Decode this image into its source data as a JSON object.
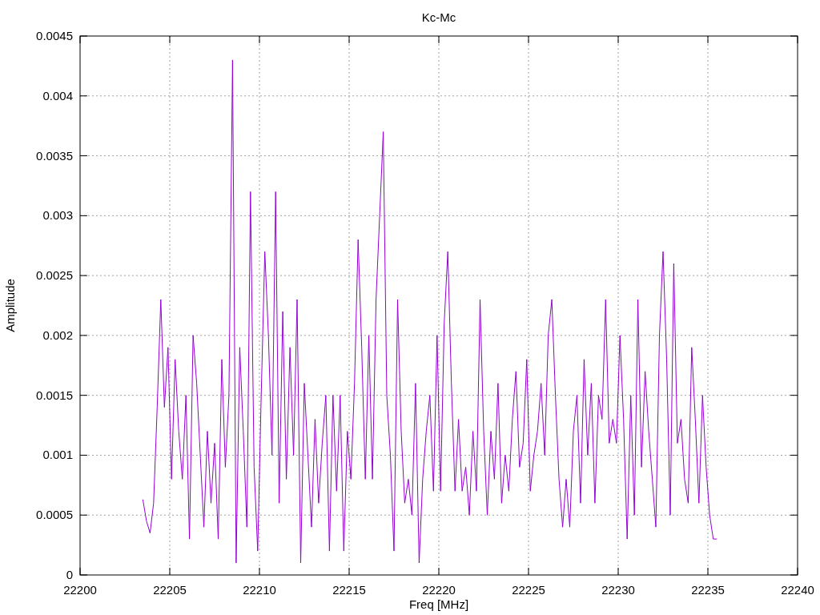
{
  "chart_data": {
    "type": "line",
    "title": "Kc-Mc",
    "xlabel": "Freq [MHz]",
    "ylabel": "Amplitude",
    "grid": true,
    "xlim": [
      22200,
      22240
    ],
    "ylim": [
      0,
      0.0045
    ],
    "xticks": [
      22200,
      22205,
      22210,
      22215,
      22220,
      22225,
      22230,
      22235,
      22240
    ],
    "yticks": [
      0,
      0.0005,
      0.001,
      0.0015,
      0.002,
      0.0025,
      0.003,
      0.0035,
      0.004,
      0.0045
    ],
    "x": [
      22203.5,
      22203.7,
      22203.9,
      22204.1,
      22204.3,
      22204.5,
      22204.7,
      22204.9,
      22205.1,
      22205.3,
      22205.5,
      22205.7,
      22205.9,
      22206.1,
      22206.3,
      22206.5,
      22206.7,
      22206.9,
      22207.1,
      22207.3,
      22207.5,
      22207.7,
      22207.9,
      22208.1,
      22208.3,
      22208.5,
      22208.7,
      22208.9,
      22209.1,
      22209.3,
      22209.5,
      22209.7,
      22209.9,
      22210.1,
      22210.3,
      22210.5,
      22210.7,
      22210.9,
      22211.1,
      22211.3,
      22211.5,
      22211.7,
      22211.9,
      22212.1,
      22212.3,
      22212.5,
      22212.7,
      22212.9,
      22213.1,
      22213.3,
      22213.5,
      22213.7,
      22213.9,
      22214.1,
      22214.3,
      22214.5,
      22214.7,
      22214.9,
      22215.1,
      22215.3,
      22215.5,
      22215.7,
      22215.9,
      22216.1,
      22216.3,
      22216.5,
      22216.7,
      22216.9,
      22217.1,
      22217.3,
      22217.5,
      22217.7,
      22217.9,
      22218.1,
      22218.3,
      22218.5,
      22218.7,
      22218.9,
      22219.1,
      22219.3,
      22219.5,
      22219.7,
      22219.9,
      22220.1,
      22220.3,
      22220.5,
      22220.7,
      22220.9,
      22221.1,
      22221.3,
      22221.5,
      22221.7,
      22221.9,
      22222.1,
      22222.3,
      22222.5,
      22222.7,
      22222.9,
      22223.1,
      22223.3,
      22223.5,
      22223.7,
      22223.9,
      22224.1,
      22224.3,
      22224.5,
      22224.7,
      22224.9,
      22225.1,
      22225.3,
      22225.5,
      22225.7,
      22225.9,
      22226.1,
      22226.3,
      22226.5,
      22226.7,
      22226.9,
      22227.1,
      22227.3,
      22227.5,
      22227.7,
      22227.9,
      22228.1,
      22228.3,
      22228.5,
      22228.7,
      22228.9,
      22229.1,
      22229.3,
      22229.5,
      22229.7,
      22229.9,
      22230.1,
      22230.3,
      22230.5,
      22230.7,
      22230.9,
      22231.1,
      22231.3,
      22231.5,
      22231.7,
      22231.9,
      22232.1,
      22232.3,
      22232.5,
      22232.7,
      22232.9,
      22233.1,
      22233.3,
      22233.5,
      22233.7,
      22233.9,
      22234.1,
      22234.3,
      22234.5,
      22234.7,
      22234.9,
      22235.1,
      22235.3,
      22235.5
    ],
    "series": [
      {
        "color": "#9400d3",
        "values": [
          0.00063,
          0.00045,
          0.00035,
          0.0006,
          0.0014,
          0.0023,
          0.0014,
          0.0019,
          0.0008,
          0.0018,
          0.0012,
          0.0008,
          0.0015,
          0.0003,
          0.002,
          0.0016,
          0.001,
          0.0004,
          0.0012,
          0.0006,
          0.0011,
          0.0003,
          0.0018,
          0.0009,
          0.0015,
          0.0043,
          0.0001,
          0.0019,
          0.0012,
          0.0004,
          0.0032,
          0.0009,
          0.0002,
          0.0015,
          0.0027,
          0.002,
          0.001,
          0.0032,
          0.0006,
          0.0022,
          0.0008,
          0.0019,
          0.001,
          0.0023,
          0.0001,
          0.0016,
          0.001,
          0.0004,
          0.0013,
          0.0006,
          0.0011,
          0.0015,
          0.0002,
          0.0015,
          0.0007,
          0.0015,
          0.0002,
          0.0012,
          0.0008,
          0.0016,
          0.0028,
          0.0019,
          0.0008,
          0.002,
          0.0008,
          0.0023,
          0.003,
          0.0037,
          0.0015,
          0.001,
          0.0002,
          0.0023,
          0.0012,
          0.0006,
          0.0008,
          0.0005,
          0.0016,
          0.0001,
          0.0008,
          0.0012,
          0.0015,
          0.0007,
          0.002,
          0.0007,
          0.0021,
          0.0027,
          0.0016,
          0.0007,
          0.0013,
          0.0007,
          0.0009,
          0.0005,
          0.0012,
          0.0007,
          0.0023,
          0.0012,
          0.0005,
          0.0012,
          0.0008,
          0.0016,
          0.0006,
          0.001,
          0.0007,
          0.0013,
          0.0017,
          0.0009,
          0.0011,
          0.0018,
          0.0007,
          0.001,
          0.0012,
          0.0016,
          0.001,
          0.002,
          0.0023,
          0.0015,
          0.0008,
          0.0004,
          0.0008,
          0.0004,
          0.0012,
          0.0015,
          0.0006,
          0.0018,
          0.001,
          0.0016,
          0.0006,
          0.0015,
          0.0013,
          0.0023,
          0.0011,
          0.0013,
          0.0011,
          0.002,
          0.0013,
          0.0003,
          0.0015,
          0.0005,
          0.0023,
          0.0009,
          0.0017,
          0.0012,
          0.0008,
          0.0004,
          0.002,
          0.0027,
          0.0018,
          0.0005,
          0.0026,
          0.0011,
          0.0013,
          0.0008,
          0.0006,
          0.0019,
          0.0013,
          0.0006,
          0.0015,
          0.0009,
          0.0005,
          0.0003,
          0.0003
        ]
      }
    ]
  }
}
